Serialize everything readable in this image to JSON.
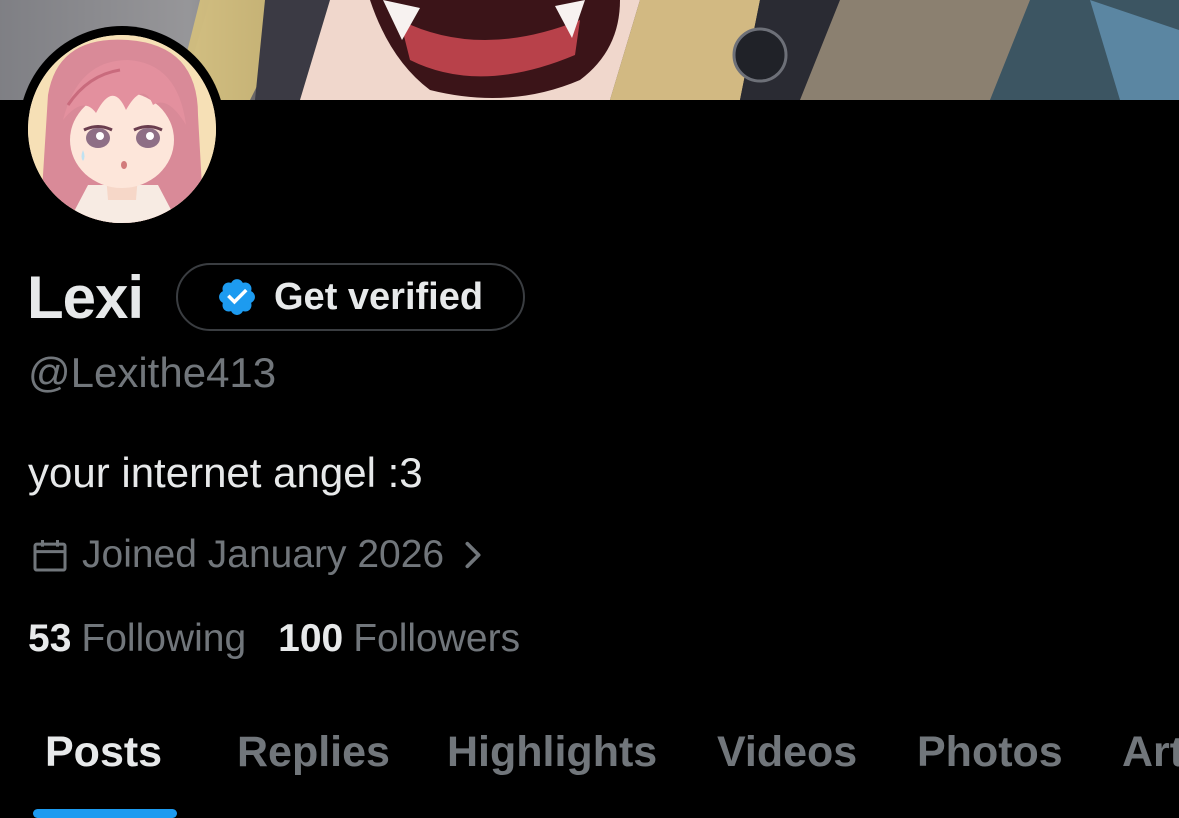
{
  "profile": {
    "name": "Lexi",
    "handle": "@Lexithe413",
    "bio": "your internet angel :3",
    "joined": "Joined January 2026",
    "verify_button": "Get verified"
  },
  "stats": {
    "following_count": "53",
    "following_label": "Following",
    "followers_count": "100",
    "followers_label": "Followers"
  },
  "tabs": [
    {
      "label": "Posts",
      "active": true
    },
    {
      "label": "Replies",
      "active": false
    },
    {
      "label": "Highlights",
      "active": false
    },
    {
      "label": "Videos",
      "active": false
    },
    {
      "label": "Photos",
      "active": false
    },
    {
      "label": "Articles",
      "active": false
    }
  ],
  "icons": {
    "verified": "verified-badge-icon",
    "calendar": "calendar-icon",
    "chevron": "chevron-right-icon"
  },
  "colors": {
    "background": "#000000",
    "text_primary": "#e7e9ea",
    "text_secondary": "#71767b",
    "accent": "#1d9bf0",
    "button_border": "#3a3d41"
  }
}
